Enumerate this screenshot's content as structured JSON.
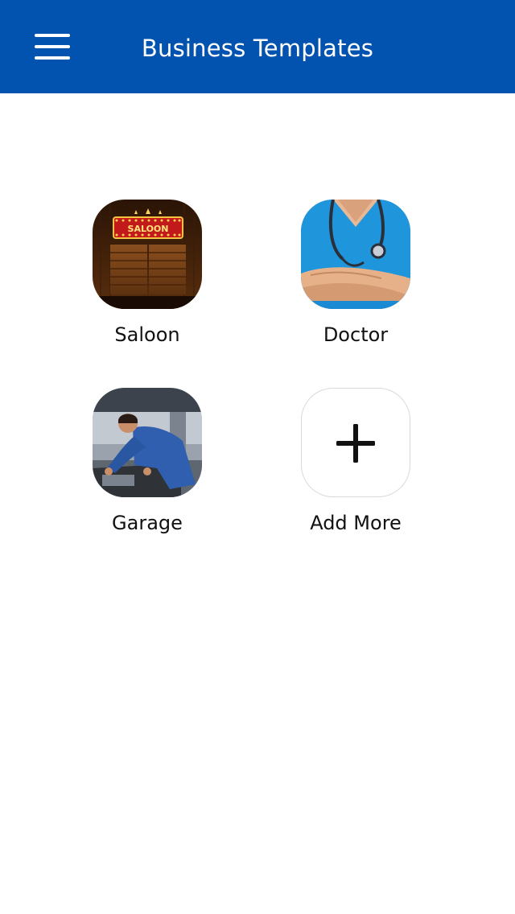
{
  "header": {
    "title": "Business Templates",
    "menu_icon": "hamburger-menu-icon",
    "background_color": "#0153AF"
  },
  "templates": [
    {
      "label": "Saloon",
      "image": "saloon-doors-image",
      "sign_text": "SALOON"
    },
    {
      "label": "Doctor",
      "image": "doctor-stethoscope-image"
    },
    {
      "label": "Garage",
      "image": "mechanic-garage-image"
    },
    {
      "label": "Add More",
      "icon": "plus-icon"
    }
  ]
}
